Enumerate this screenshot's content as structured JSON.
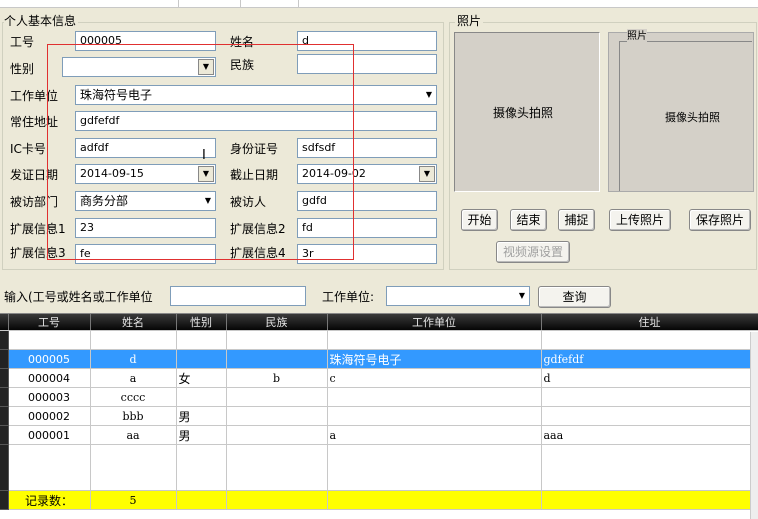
{
  "info_panel": {
    "title": "个人基本信息",
    "labels": {
      "emp_id": "工号",
      "name": "姓名",
      "gender": "性别",
      "ethnicity": "民族",
      "workplace": "工作单位",
      "address": "常住地址",
      "ic_card": "IC卡号",
      "id_number": "身份证号",
      "issue_date": "发证日期",
      "expiry_date": "截止日期",
      "visit_dept": "被访部门",
      "visitee": "被访人",
      "ext1": "扩展信息1",
      "ext2": "扩展信息2",
      "ext3": "扩展信息3",
      "ext4": "扩展信息4"
    },
    "values": {
      "emp_id": "000005",
      "name": "d",
      "gender": "",
      "ethnicity": "",
      "workplace": "珠海符号电子",
      "address": "gdfefdf",
      "ic_card": "adfdf",
      "id_number": "sdfsdf",
      "issue_date": "2014-09-15",
      "expiry_date": "2014-09-02",
      "visit_dept": "商务分部",
      "visitee": "gdfd",
      "ext1": "23",
      "ext2": "fd",
      "ext3": "fe",
      "ext4": "3r"
    }
  },
  "photo_panel": {
    "title": "照片",
    "camera_label": "摄像头拍照",
    "preview_title": "照片",
    "preview_label": "摄像头拍照",
    "buttons": {
      "start": "开始",
      "stop": "结束",
      "capture": "捕捉",
      "upload": "上传照片",
      "save": "保存照片",
      "video_source": "视频源设置"
    }
  },
  "search_bar": {
    "input_label": "输入(工号或姓名或工作单位",
    "input_value": "",
    "workplace_label": "工作单位:",
    "workplace_value": "",
    "query_button": "查询"
  },
  "table": {
    "columns": [
      "工号",
      "姓名",
      "性别",
      "民族",
      "工作单位",
      "住址"
    ],
    "rows": [
      [
        "000005",
        "d",
        "",
        "",
        "珠海符号电子",
        "gdfefdf"
      ],
      [
        "000004",
        "a",
        "女",
        "b",
        "c",
        "d"
      ],
      [
        "000003",
        "cccc",
        "",
        "",
        "",
        ""
      ],
      [
        "000002",
        "bbb",
        "男",
        "",
        "",
        ""
      ],
      [
        "000001",
        "aa",
        "男",
        "",
        "a",
        "aaa"
      ]
    ],
    "footer_label": "记录数：",
    "footer_count": "5"
  },
  "colors": {
    "selected_row": "#3399ff",
    "footer_bg": "#ffff00",
    "annotation_box": "#e03030"
  }
}
